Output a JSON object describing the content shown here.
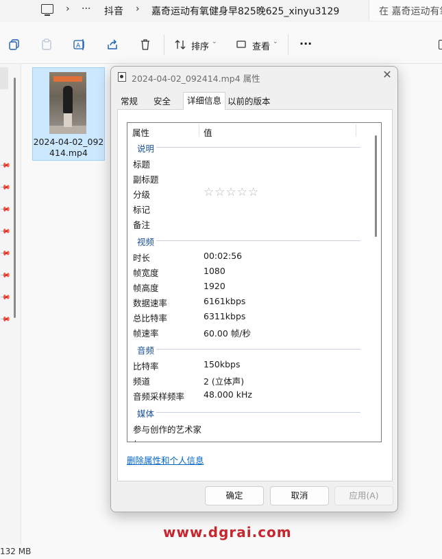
{
  "breadcrumb": {
    "ellipsis": "···",
    "parent": "抖音",
    "current": "嘉奇运动有氧健身早825晚625_xinyu3129"
  },
  "search": {
    "placeholder": "在 嘉奇运动有氧"
  },
  "toolbar": {
    "sort_label": "排序",
    "view_label": "查看",
    "more_label": "···"
  },
  "file": {
    "name": "2024-04-02_092414.mp4"
  },
  "status": {
    "size": "132 MB"
  },
  "dialog": {
    "title": "2024-04-02_092414.mp4 属性",
    "close": "✕",
    "tabs": [
      {
        "label": "常规"
      },
      {
        "label": "安全"
      },
      {
        "label": "详细信息"
      },
      {
        "label": "以前的版本"
      }
    ],
    "columns": {
      "property": "属性",
      "value": "值"
    },
    "sections": {
      "description": {
        "title": "说明",
        "rows": [
          {
            "name": "标题",
            "value": ""
          },
          {
            "name": "副标题",
            "value": ""
          },
          {
            "name": "分级",
            "value": "☆☆☆☆☆"
          },
          {
            "name": "标记",
            "value": ""
          },
          {
            "name": "备注",
            "value": ""
          }
        ]
      },
      "video": {
        "title": "视频",
        "rows": [
          {
            "name": "时长",
            "value": "00:02:56"
          },
          {
            "name": "帧宽度",
            "value": "1080"
          },
          {
            "name": "帧高度",
            "value": "1920"
          },
          {
            "name": "数据速率",
            "value": "6161kbps"
          },
          {
            "name": "总比特率",
            "value": "6311kbps"
          },
          {
            "name": "帧速率",
            "value": "60.00 帧/秒"
          }
        ]
      },
      "audio": {
        "title": "音频",
        "rows": [
          {
            "name": "比特率",
            "value": "150kbps"
          },
          {
            "name": "频道",
            "value": "2 (立体声)"
          },
          {
            "name": "音频采样频率",
            "value": "48.000 kHz"
          }
        ]
      },
      "media": {
        "title": "媒体",
        "rows": [
          {
            "name": "参与创作的艺术家",
            "value": ""
          },
          {
            "name": "年",
            "value": ""
          }
        ]
      }
    },
    "rating_stars": 0,
    "delete_link": "删除属性和个人信息",
    "buttons": {
      "ok": "确定",
      "cancel": "取消",
      "apply": "应用(A)"
    }
  },
  "watermark": "www.dgrai.com"
}
